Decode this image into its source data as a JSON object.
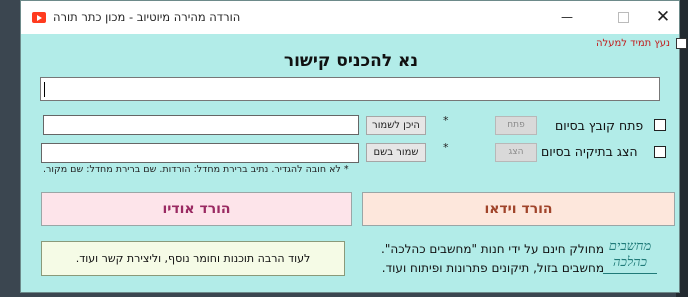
{
  "window": {
    "title": "הורדה מהירה מיוטיוב - מכון כתר תורה",
    "min_glyph": "—",
    "close_glyph": "✕"
  },
  "always_on_top": {
    "label": "נעץ תמיד למעלה",
    "checked": false
  },
  "heading": "נא להכניס קישור",
  "url_input": {
    "value": "",
    "placeholder": ""
  },
  "save_location": {
    "value": "",
    "button": "היכן לשמור",
    "star": "*"
  },
  "save_name": {
    "value": "",
    "button": "שמור בשם",
    "star": "*"
  },
  "open_on_finish": {
    "label": "פתח קובץ בסיום",
    "button": "פתח",
    "checked": false
  },
  "show_folder_on_finish": {
    "label": "הצג בתיקיה בסיום",
    "button": "הצג",
    "checked": false
  },
  "note": "* לא חובה להגדיר. נתיב ברירת מחדל: הורדות. שם ברירת מחדל: שם מקור.",
  "download_video_button": "הורד וידאו",
  "download_audio_button": "הורד אודיו",
  "promo_button": "לעוד הרבה תוכנות וחומר נוסף, וליצירת קשר ועוד.",
  "promo_text": {
    "line1": "מחולק חינם על ידי חנות \"מחשבים כהלכה\".",
    "line2": "מחשבים בזול, תיקונים פתרונות ופיתוח ועוד."
  },
  "logo": {
    "line1": "מחשבים",
    "line2": "כהלכה"
  },
  "colors": {
    "window_bg": "#b2ece8",
    "ontop_label": "#c21b1b",
    "audio_button_bg": "#fde4ea",
    "audio_button_text": "#9a2a62",
    "video_button_bg": "#fde7dc",
    "video_button_text": "#a0442a",
    "logo": "#1f7a78"
  }
}
